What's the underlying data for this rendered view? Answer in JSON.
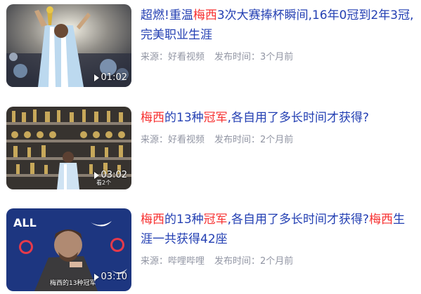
{
  "results": [
    {
      "title_parts": [
        {
          "text": "超燃!重温",
          "hl": false
        },
        {
          "text": "梅西",
          "hl": true
        },
        {
          "text": "3次大赛捧杯瞬间,16年0冠到2年3冠,完美职业生涯",
          "hl": false
        }
      ],
      "source": "来源：好看视频",
      "publish_time": "发布时间：3个月前",
      "duration": "01:02"
    },
    {
      "title_parts": [
        {
          "text": "梅西",
          "hl": true
        },
        {
          "text": "的13种",
          "hl": false
        },
        {
          "text": "冠军",
          "hl": true
        },
        {
          "text": ",各自用了多长时间才获得?",
          "hl": false
        }
      ],
      "source": "来源：好看视频",
      "publish_time": "发布时间：2个月前",
      "duration": "03:02",
      "thumb_caption": "看2个"
    },
    {
      "title_parts": [
        {
          "text": "梅西",
          "hl": true
        },
        {
          "text": "的13种",
          "hl": false
        },
        {
          "text": "冠军",
          "hl": true
        },
        {
          "text": ",各自用了多长时间才获得?",
          "hl": false
        },
        {
          "text": "梅西",
          "hl": true
        },
        {
          "text": "生涯一共获得42座",
          "hl": false
        }
      ],
      "source": "来源：哔哩哔哩",
      "publish_time": "发布时间：2个月前",
      "duration": "03:10",
      "thumb_caption": "梅西的13种冠军"
    }
  ],
  "colors": {
    "title": "#2440b3",
    "highlight": "#f73131",
    "meta": "#9195a3"
  }
}
